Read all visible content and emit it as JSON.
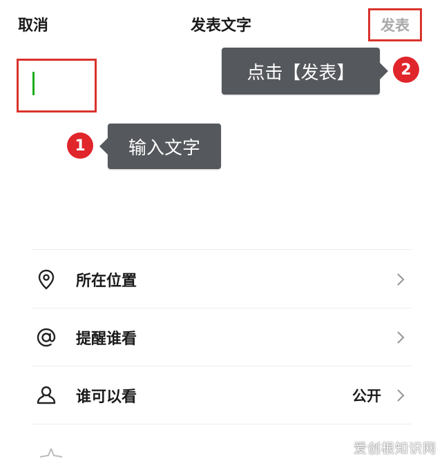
{
  "header": {
    "cancel_label": "取消",
    "title": "发表文字",
    "publish_label": "发表"
  },
  "annotations": {
    "step1_number": "1",
    "step1_text": "输入文字",
    "step2_number": "2",
    "step2_text": "点击【发表】",
    "highlight_color": "#d9322b",
    "tooltip_color": "#55585c"
  },
  "options": [
    {
      "icon": "location-pin-icon",
      "label": "所在位置",
      "value": ""
    },
    {
      "icon": "at-sign-icon",
      "label": "提醒谁看",
      "value": ""
    },
    {
      "icon": "person-icon",
      "label": "谁可以看",
      "value": "公开"
    }
  ],
  "watermark": "爱创根知识网",
  "colors": {
    "cursor": "#1aad19",
    "badge": "#e0252b",
    "disabled_text": "#a9a9a9"
  }
}
